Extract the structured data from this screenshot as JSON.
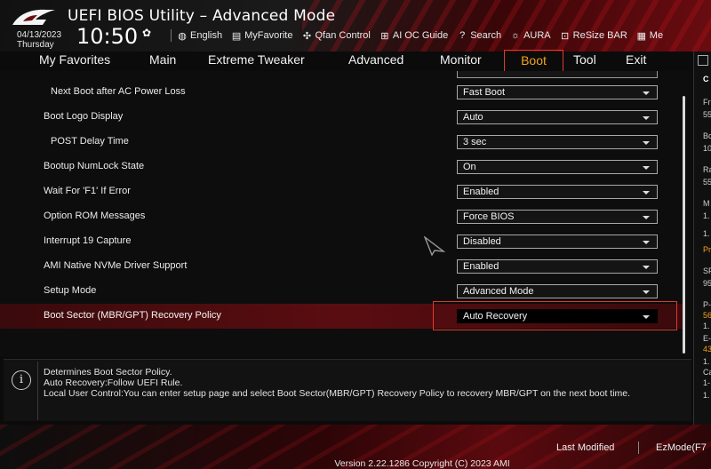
{
  "header": {
    "title": "UEFI BIOS Utility – Advanced Mode",
    "date": "04/13/2023",
    "day": "Thursday",
    "time": "10:50",
    "toolbar": [
      {
        "icon": "globe-icon",
        "label": "English"
      },
      {
        "icon": "myfavorite-icon",
        "label": "MyFavorite"
      },
      {
        "icon": "fan-icon",
        "label": "Qfan Control"
      },
      {
        "icon": "ai-oc-icon",
        "label": "AI OC Guide"
      },
      {
        "icon": "search-icon",
        "label": "Search"
      },
      {
        "icon": "aura-icon",
        "label": "AURA"
      },
      {
        "icon": "resize-bar-icon",
        "label": "ReSize BAR"
      },
      {
        "icon": "memtest-icon",
        "label": "Me"
      }
    ]
  },
  "nav": {
    "tabs": [
      "My Favorites",
      "Main",
      "Extreme Tweaker",
      "Advanced",
      "Monitor",
      "Boot",
      "Tool",
      "Exit"
    ],
    "active": "Boot"
  },
  "settings": [
    {
      "label": "Next Boot after AC Power Loss",
      "value": "Fast Boot",
      "indent": true
    },
    {
      "label": "Boot Logo Display",
      "value": "Auto",
      "indent": false
    },
    {
      "label": "POST Delay Time",
      "value": "3 sec",
      "indent": true
    },
    {
      "label": "Bootup NumLock State",
      "value": "On",
      "indent": false
    },
    {
      "label": "Wait For 'F1' If Error",
      "value": "Enabled",
      "indent": false
    },
    {
      "label": "Option ROM Messages",
      "value": "Force BIOS",
      "indent": false
    },
    {
      "label": "Interrupt 19 Capture",
      "value": "Disabled",
      "indent": false
    },
    {
      "label": "AMI Native NVMe Driver Support",
      "value": "Enabled",
      "indent": false
    },
    {
      "label": "Setup Mode",
      "value": "Advanced Mode",
      "indent": false
    },
    {
      "label": "Boot Sector (MBR/GPT) Recovery Policy",
      "value": "Auto Recovery",
      "indent": false,
      "selected": true
    }
  ],
  "help": {
    "lines": [
      "Determines Boot Sector Policy.",
      " Auto Recovery:Follow UEFI Rule.",
      " Local User Control:You can enter setup page and select Boot Sector(MBR/GPT) Recovery Policy to recovery MBR/GPT on the next boot time."
    ]
  },
  "right_panel": {
    "texts": [
      {
        "text": "C",
        "style": "bold"
      },
      {
        "text": "Fr",
        "style": "normal"
      },
      {
        "text": "55",
        "style": "normal"
      },
      {
        "text": "Bc",
        "style": "normal"
      },
      {
        "text": "10",
        "style": "normal"
      },
      {
        "text": "Ra",
        "style": "normal"
      },
      {
        "text": "55",
        "style": "normal"
      },
      {
        "text": "M",
        "style": "normal"
      },
      {
        "text": "1.",
        "style": "normal"
      },
      {
        "text": "1.",
        "style": "normal"
      },
      {
        "text": "Pr",
        "style": "orange"
      },
      {
        "text": "SF",
        "style": "normal"
      },
      {
        "text": "95",
        "style": "normal"
      },
      {
        "text": "P-",
        "style": "normal"
      },
      {
        "text": "56",
        "style": "orange"
      },
      {
        "text": "1.",
        "style": "normal"
      },
      {
        "text": "E-",
        "style": "normal"
      },
      {
        "text": "43",
        "style": "orange"
      },
      {
        "text": "1.",
        "style": "normal"
      },
      {
        "text": "Ca",
        "style": "normal"
      },
      {
        "text": "1-",
        "style": "normal"
      },
      {
        "text": "1.",
        "style": "normal"
      }
    ]
  },
  "footer": {
    "last_modified": "Last Modified",
    "ezmode": "EzMode(F7",
    "version": "Version 2.22.1286 Copyright (C) 2023 AMI"
  },
  "colors": {
    "accent": "#f3a21a",
    "highlight_border": "#e0392c",
    "selected_row": "#5a0d10"
  }
}
